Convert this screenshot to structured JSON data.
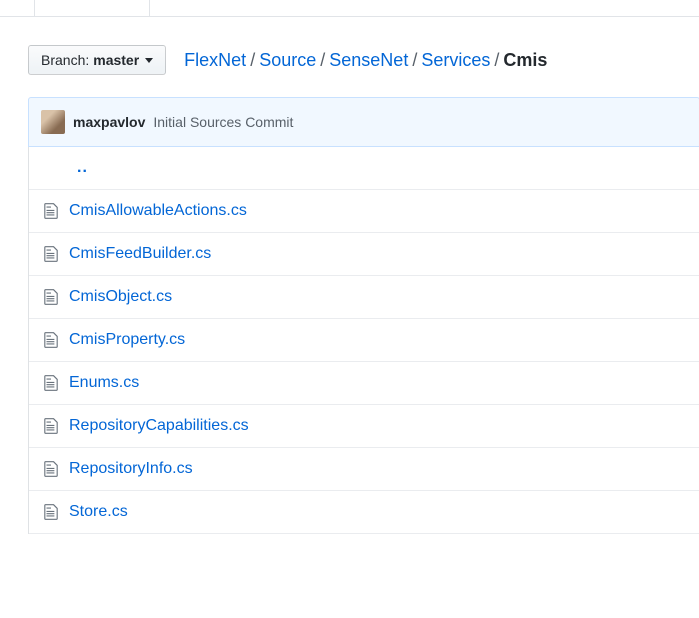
{
  "branchSelector": {
    "label": "Branch:",
    "branch": "master"
  },
  "breadcrumbs": [
    {
      "label": "FlexNet",
      "current": false
    },
    {
      "label": "Source",
      "current": false
    },
    {
      "label": "SenseNet",
      "current": false
    },
    {
      "label": "Services",
      "current": false
    },
    {
      "label": "Cmis",
      "current": true
    }
  ],
  "latestCommit": {
    "author": "maxpavlov",
    "message": "Initial Sources Commit"
  },
  "parentDir": "..",
  "files": [
    {
      "name": "CmisAllowableActions.cs"
    },
    {
      "name": "CmisFeedBuilder.cs"
    },
    {
      "name": "CmisObject.cs"
    },
    {
      "name": "CmisProperty.cs"
    },
    {
      "name": "Enums.cs"
    },
    {
      "name": "RepositoryCapabilities.cs"
    },
    {
      "name": "RepositoryInfo.cs"
    },
    {
      "name": "Store.cs"
    }
  ]
}
